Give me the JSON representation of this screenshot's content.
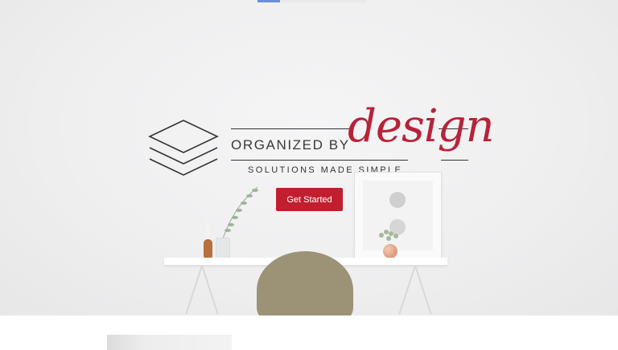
{
  "brand": {
    "name": "ORGANIZED BY",
    "script": "design",
    "tagline": "SOLUTIONS MADE SIMPLE",
    "accent_color": "#c11f30",
    "icon": "stacked-layers-icon"
  },
  "hero": {
    "cta_label": "Get Started"
  }
}
